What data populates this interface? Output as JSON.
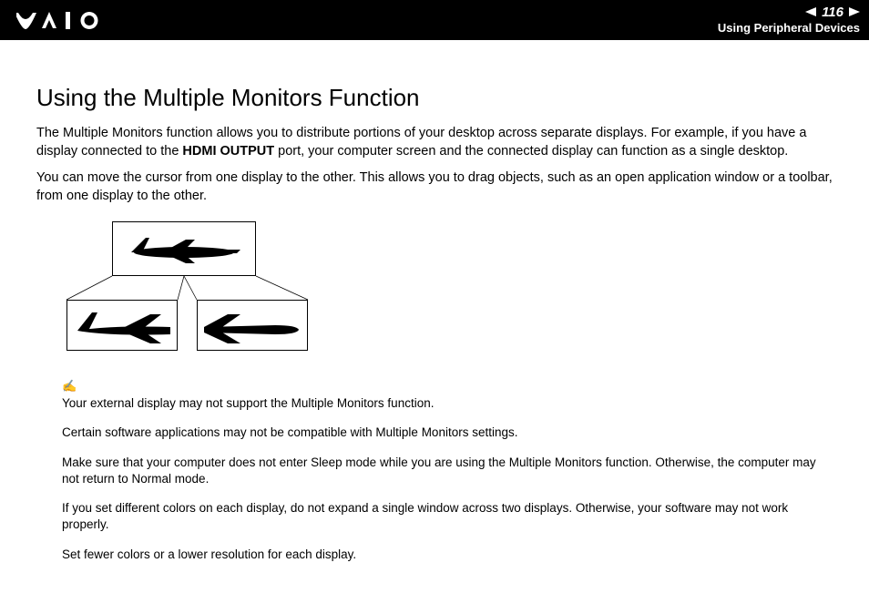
{
  "header": {
    "page_number": "116",
    "breadcrumb": "Using Peripheral Devices"
  },
  "title": "Using the Multiple Monitors Function",
  "paragraphs": {
    "p1_before": "The Multiple Monitors function allows you to distribute portions of your desktop across separate displays. For example, if you have a display connected to the ",
    "p1_bold": "HDMI OUTPUT",
    "p1_after": " port, your computer screen and the connected display can function as a single desktop.",
    "p2": "You can move the cursor from one display to the other. This allows you to drag objects, such as an open application window or a toolbar, from one display to the other."
  },
  "notes": {
    "n1": "Your external display may not support the Multiple Monitors function.",
    "n2": "Certain software applications may not be compatible with Multiple Monitors settings.",
    "n3": "Make sure that your computer does not enter Sleep mode while you are using the Multiple Monitors function. Otherwise, the computer may not return to Normal mode.",
    "n4": "If you set different colors on each display, do not expand a single window across two displays. Otherwise, your software may not work properly.",
    "n5": "Set fewer colors or a lower resolution for each display."
  }
}
